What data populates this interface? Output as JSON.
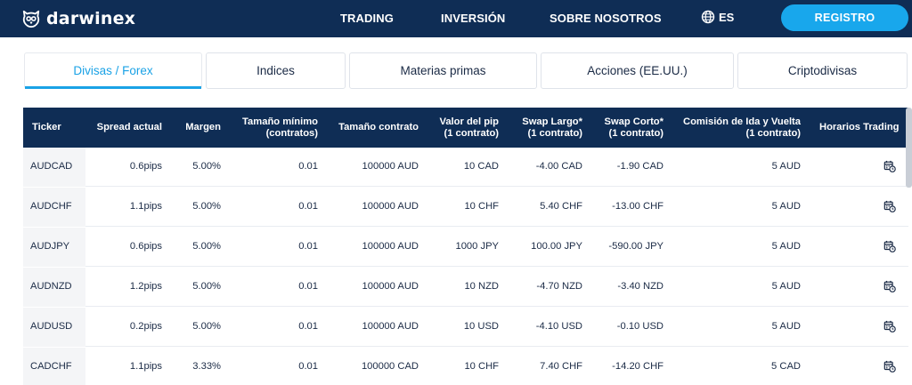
{
  "nav": {
    "logo_text": "darwinex",
    "items": [
      "TRADING",
      "INVERSIÓN",
      "SOBRE NOSOTROS"
    ],
    "language": "ES",
    "register_label": "REGISTRO"
  },
  "tabs": [
    "Divisas / Forex",
    "Indices",
    "Materias primas",
    "Acciones (EE.UU.)",
    "Criptodivisas"
  ],
  "active_tab": "Divisas / Forex",
  "table": {
    "headers": [
      [
        "Ticker"
      ],
      [
        "Spread actual"
      ],
      [
        "Margen"
      ],
      [
        "Tamaño mínimo",
        "(contratos)"
      ],
      [
        "Tamaño contrato"
      ],
      [
        "Valor del pip",
        "(1 contrato)"
      ],
      [
        "Swap Largo*",
        "(1 contrato)"
      ],
      [
        "Swap Corto*",
        "(1 contrato)"
      ],
      [
        "Comisión de Ida y Vuelta",
        "(1 contrato)"
      ],
      [
        "Horarios Trading"
      ]
    ],
    "rows": [
      [
        "AUDCAD",
        "0.6pips",
        "5.00%",
        "0.01",
        "100000 AUD",
        "10 CAD",
        "-4.00 CAD",
        "-1.90 CAD",
        "5 AUD"
      ],
      [
        "AUDCHF",
        "1.1pips",
        "5.00%",
        "0.01",
        "100000 AUD",
        "10 CHF",
        "5.40 CHF",
        "-13.00 CHF",
        "5 AUD"
      ],
      [
        "AUDJPY",
        "0.6pips",
        "5.00%",
        "0.01",
        "100000 AUD",
        "1000 JPY",
        "100.00 JPY",
        "-590.00 JPY",
        "5 AUD"
      ],
      [
        "AUDNZD",
        "1.2pips",
        "5.00%",
        "0.01",
        "100000 AUD",
        "10 NZD",
        "-4.70 NZD",
        "-3.40 NZD",
        "5 AUD"
      ],
      [
        "AUDUSD",
        "0.2pips",
        "5.00%",
        "0.01",
        "100000 AUD",
        "10 USD",
        "-4.10 USD",
        "-0.10 USD",
        "5 AUD"
      ],
      [
        "CADCHF",
        "1.1pips",
        "3.33%",
        "0.01",
        "100000 CAD",
        "10 CHF",
        "7.40 CHF",
        "-14.20 CHF",
        "5 CAD"
      ]
    ],
    "schedule_icon": "calendar-clock-icon"
  },
  "colors": {
    "navy": "#0f2d55",
    "accent": "#18a7ec",
    "text": "#1a2a45"
  }
}
